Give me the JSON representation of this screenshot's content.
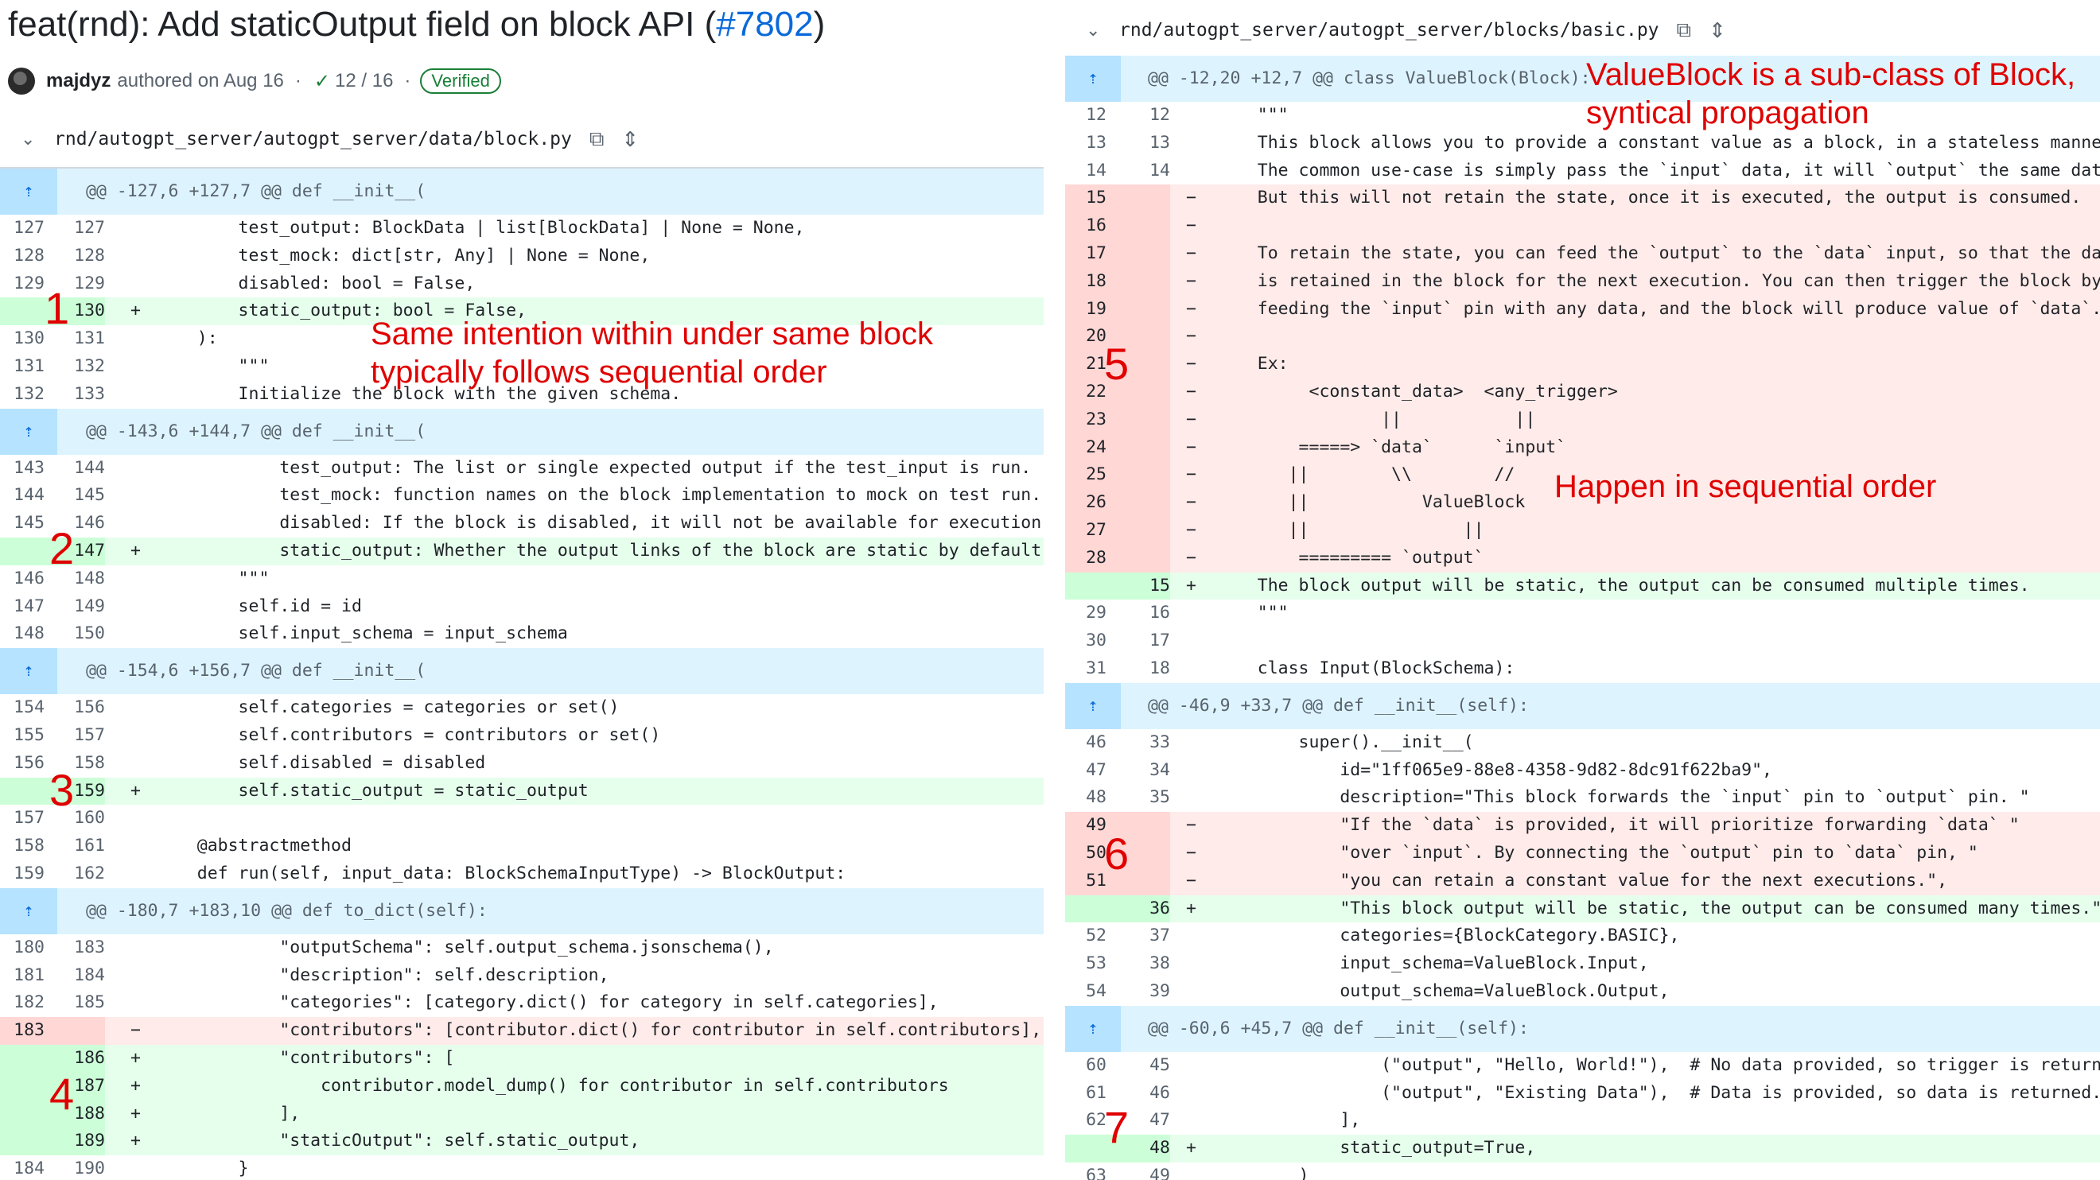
{
  "pr": {
    "title": "feat(rnd): Add staticOutput field on block API (",
    "number": "#7802",
    "title_close": ")",
    "author": "majdyz",
    "authored_text": "authored on Aug 16",
    "dot": "·",
    "checks_icon": "check-icon",
    "checks": "12 / 16",
    "verified": "Verified"
  },
  "left_file": {
    "path": "rnd/autogpt_server/autogpt_server/data/block.py",
    "chevron": "⌄",
    "copy_icon": "⧉",
    "expand_icon": "⇕"
  },
  "right_file": {
    "path": "rnd/autogpt_server/autogpt_server/blocks/basic.py",
    "chevron": "⌄",
    "copy_icon": "⧉",
    "expand_icon": "⇕"
  },
  "left_rows": [
    {
      "t": "hunk",
      "code": "@@ -127,6 +127,7 @@ def __init__("
    },
    {
      "t": "ctx",
      "a": "127",
      "b": "127",
      "code": "        test_output: BlockData | list[BlockData] | None = None,"
    },
    {
      "t": "ctx",
      "a": "128",
      "b": "128",
      "code": "        test_mock: dict[str, Any] | None = None,"
    },
    {
      "t": "ctx",
      "a": "129",
      "b": "129",
      "code": "        disabled: bool = False,"
    },
    {
      "t": "add",
      "a": "",
      "b": "130",
      "code": "        static_output: bool = False,"
    },
    {
      "t": "ctx",
      "a": "130",
      "b": "131",
      "code": "    ):"
    },
    {
      "t": "ctx",
      "a": "131",
      "b": "132",
      "code": "        \"\"\""
    },
    {
      "t": "ctx",
      "a": "132",
      "b": "133",
      "code": "        Initialize the block with the given schema."
    },
    {
      "t": "hunk",
      "code": "@@ -143,6 +144,7 @@ def __init__("
    },
    {
      "t": "ctx",
      "a": "143",
      "b": "144",
      "code": "            test_output: The list or single expected output if the test_input is run."
    },
    {
      "t": "ctx",
      "a": "144",
      "b": "145",
      "code": "            test_mock: function names on the block implementation to mock on test run."
    },
    {
      "t": "ctx",
      "a": "145",
      "b": "146",
      "code": "            disabled: If the block is disabled, it will not be available for execution."
    },
    {
      "t": "add",
      "a": "",
      "b": "147",
      "code": "            static_output: Whether the output links of the block are static by default."
    },
    {
      "t": "ctx",
      "a": "146",
      "b": "148",
      "code": "        \"\"\""
    },
    {
      "t": "ctx",
      "a": "147",
      "b": "149",
      "code": "        self.id = id"
    },
    {
      "t": "ctx",
      "a": "148",
      "b": "150",
      "code": "        self.input_schema = input_schema"
    },
    {
      "t": "hunk",
      "code": "@@ -154,6 +156,7 @@ def __init__("
    },
    {
      "t": "ctx",
      "a": "154",
      "b": "156",
      "code": "        self.categories = categories or set()"
    },
    {
      "t": "ctx",
      "a": "155",
      "b": "157",
      "code": "        self.contributors = contributors or set()"
    },
    {
      "t": "ctx",
      "a": "156",
      "b": "158",
      "code": "        self.disabled = disabled"
    },
    {
      "t": "add",
      "a": "",
      "b": "159",
      "code": "        self.static_output = static_output"
    },
    {
      "t": "ctx",
      "a": "157",
      "b": "160",
      "code": ""
    },
    {
      "t": "ctx",
      "a": "158",
      "b": "161",
      "code": "    @abstractmethod"
    },
    {
      "t": "ctx",
      "a": "159",
      "b": "162",
      "code": "    def run(self, input_data: BlockSchemaInputType) -> BlockOutput:"
    },
    {
      "t": "hunk",
      "code": "@@ -180,7 +183,10 @@ def to_dict(self):"
    },
    {
      "t": "ctx",
      "a": "180",
      "b": "183",
      "code": "            \"outputSchema\": self.output_schema.jsonschema(),"
    },
    {
      "t": "ctx",
      "a": "181",
      "b": "184",
      "code": "            \"description\": self.description,"
    },
    {
      "t": "ctx",
      "a": "182",
      "b": "185",
      "code": "            \"categories\": [category.dict() for category in self.categories],"
    },
    {
      "t": "del",
      "a": "183",
      "b": "",
      "code": "            \"contributors\": [contributor.dict() for contributor in self.contributors],"
    },
    {
      "t": "add",
      "a": "",
      "b": "186",
      "code": "            \"contributors\": ["
    },
    {
      "t": "add",
      "a": "",
      "b": "187",
      "code": "                contributor.model_dump() for contributor in self.contributors"
    },
    {
      "t": "add",
      "a": "",
      "b": "188",
      "code": "            ],"
    },
    {
      "t": "add",
      "a": "",
      "b": "189",
      "code": "            \"staticOutput\": self.static_output,"
    },
    {
      "t": "ctx",
      "a": "184",
      "b": "190",
      "code": "        }"
    }
  ],
  "right_rows": [
    {
      "t": "hunk",
      "code": "@@ -12,20 +12,7 @@ class ValueBlock(Block):"
    },
    {
      "t": "ctx",
      "a": "12",
      "b": "12",
      "code": "    \"\"\""
    },
    {
      "t": "ctx",
      "a": "13",
      "b": "13",
      "code": "    This block allows you to provide a constant value as a block, in a stateless manner."
    },
    {
      "t": "ctx",
      "a": "14",
      "b": "14",
      "code": "    The common use-case is simply pass the `input` data, it will `output` the same data."
    },
    {
      "t": "del",
      "a": "15",
      "b": "",
      "code": "    But this will not retain the state, once it is executed, the output is consumed."
    },
    {
      "t": "del",
      "a": "16",
      "b": "",
      "code": ""
    },
    {
      "t": "del",
      "a": "17",
      "b": "",
      "code": "    To retain the state, you can feed the `output` to the `data` input, so that the data"
    },
    {
      "t": "del",
      "a": "18",
      "b": "",
      "code": "    is retained in the block for the next execution. You can then trigger the block by"
    },
    {
      "t": "del",
      "a": "19",
      "b": "",
      "code": "    feeding the `input` pin with any data, and the block will produce value of `data`."
    },
    {
      "t": "del",
      "a": "20",
      "b": "",
      "code": ""
    },
    {
      "t": "del",
      "a": "21",
      "b": "",
      "code": "    Ex:"
    },
    {
      "t": "del",
      "a": "22",
      "b": "",
      "code": "         <constant_data>  <any_trigger>"
    },
    {
      "t": "del",
      "a": "23",
      "b": "",
      "code": "                ||           ||"
    },
    {
      "t": "del",
      "a": "24",
      "b": "",
      "code": "        =====> `data`      `input`"
    },
    {
      "t": "del",
      "a": "25",
      "b": "",
      "code": "       ||        \\\\        //"
    },
    {
      "t": "del",
      "a": "26",
      "b": "",
      "code": "       ||           ValueBlock"
    },
    {
      "t": "del",
      "a": "27",
      "b": "",
      "code": "       ||               ||"
    },
    {
      "t": "del",
      "a": "28",
      "b": "",
      "code": "        ========= `output`"
    },
    {
      "t": "add",
      "a": "",
      "b": "15",
      "code": "    The block output will be static, the output can be consumed multiple times."
    },
    {
      "t": "ctx",
      "a": "29",
      "b": "16",
      "code": "    \"\"\""
    },
    {
      "t": "ctx",
      "a": "30",
      "b": "17",
      "code": ""
    },
    {
      "t": "ctx",
      "a": "31",
      "b": "18",
      "code": "    class Input(BlockSchema):"
    },
    {
      "t": "hunk",
      "code": "@@ -46,9 +33,7 @@ def __init__(self):"
    },
    {
      "t": "ctx",
      "a": "46",
      "b": "33",
      "code": "        super().__init__("
    },
    {
      "t": "ctx",
      "a": "47",
      "b": "34",
      "code": "            id=\"1ff065e9-88e8-4358-9d82-8dc91f622ba9\","
    },
    {
      "t": "ctx",
      "a": "48",
      "b": "35",
      "code": "            description=\"This block forwards the `input` pin to `output` pin. \""
    },
    {
      "t": "del",
      "a": "49",
      "b": "",
      "code": "            \"If the `data` is provided, it will prioritize forwarding `data` \""
    },
    {
      "t": "del",
      "a": "50",
      "b": "",
      "code": "            \"over `input`. By connecting the `output` pin to `data` pin, \""
    },
    {
      "t": "del",
      "a": "51",
      "b": "",
      "code": "            \"you can retain a constant value for the next executions.\","
    },
    {
      "t": "add",
      "a": "",
      "b": "36",
      "code": "            \"This block output will be static, the output can be consumed many times.\","
    },
    {
      "t": "ctx",
      "a": "52",
      "b": "37",
      "code": "            categories={BlockCategory.BASIC},"
    },
    {
      "t": "ctx",
      "a": "53",
      "b": "38",
      "code": "            input_schema=ValueBlock.Input,"
    },
    {
      "t": "ctx",
      "a": "54",
      "b": "39",
      "code": "            output_schema=ValueBlock.Output,"
    },
    {
      "t": "hunk",
      "code": "@@ -60,6 +45,7 @@ def __init__(self):"
    },
    {
      "t": "ctx",
      "a": "60",
      "b": "45",
      "code": "                (\"output\", \"Hello, World!\"),  # No data provided, so trigger is returned"
    },
    {
      "t": "ctx",
      "a": "61",
      "b": "46",
      "code": "                (\"output\", \"Existing Data\"),  # Data is provided, so data is returned."
    },
    {
      "t": "ctx",
      "a": "62",
      "b": "47",
      "code": "            ],"
    },
    {
      "t": "add",
      "a": "",
      "b": "48",
      "code": "            static_output=True,"
    },
    {
      "t": "ctx",
      "a": "63",
      "b": "49",
      "code": "        )"
    }
  ],
  "annotations": {
    "left_note_line1": "Same intention within under same block",
    "left_note_line2": "typically follows sequential order",
    "right_top_line1": "ValueBlock is a sub-class of Block,",
    "right_top_line2": "syntical propagation",
    "right_mid": "Happen in sequential order",
    "markers": [
      "1",
      "2",
      "3",
      "4",
      "5",
      "6",
      "7"
    ]
  },
  "colors": {
    "add_bg": "#e6ffec",
    "add_num_bg": "#ccffd8",
    "del_bg": "#ffebe9",
    "del_num_bg": "#ffd7d5",
    "hunk_bg": "#ddf4ff",
    "annotation": "#e00000",
    "link": "#0969da",
    "verified": "#1a7f37"
  }
}
